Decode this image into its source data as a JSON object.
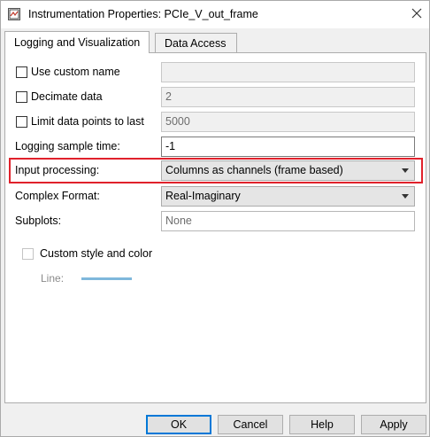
{
  "window": {
    "title": "Instrumentation Properties: PCIe_V_out_frame"
  },
  "tabs": [
    {
      "label": "Logging and Visualization",
      "active": true
    },
    {
      "label": "Data Access",
      "active": false
    }
  ],
  "options": {
    "use_custom_name": {
      "label": "Use custom name",
      "checked": false,
      "value": ""
    },
    "decimate_data": {
      "label": "Decimate data",
      "checked": false,
      "value": "2"
    },
    "limit_points": {
      "label": "Limit data points to last",
      "checked": false,
      "value": "5000"
    },
    "logging_sample_time": {
      "label": "Logging sample time:",
      "value": "-1"
    },
    "input_processing": {
      "label": "Input processing:",
      "value": "Columns as channels (frame based)"
    },
    "complex_format": {
      "label": "Complex Format:",
      "value": "Real-Imaginary"
    },
    "subplots": {
      "label": "Subplots:",
      "placeholder": "None"
    },
    "custom_style": {
      "label": "Custom style and color",
      "checked": false
    },
    "line": {
      "label": "Line:",
      "color": "#7fb8dc"
    }
  },
  "buttons": {
    "ok": "OK",
    "cancel": "Cancel",
    "help": "Help",
    "apply": "Apply"
  },
  "colors": {
    "highlight": "#e0212b",
    "primary_border": "#0078d7"
  }
}
